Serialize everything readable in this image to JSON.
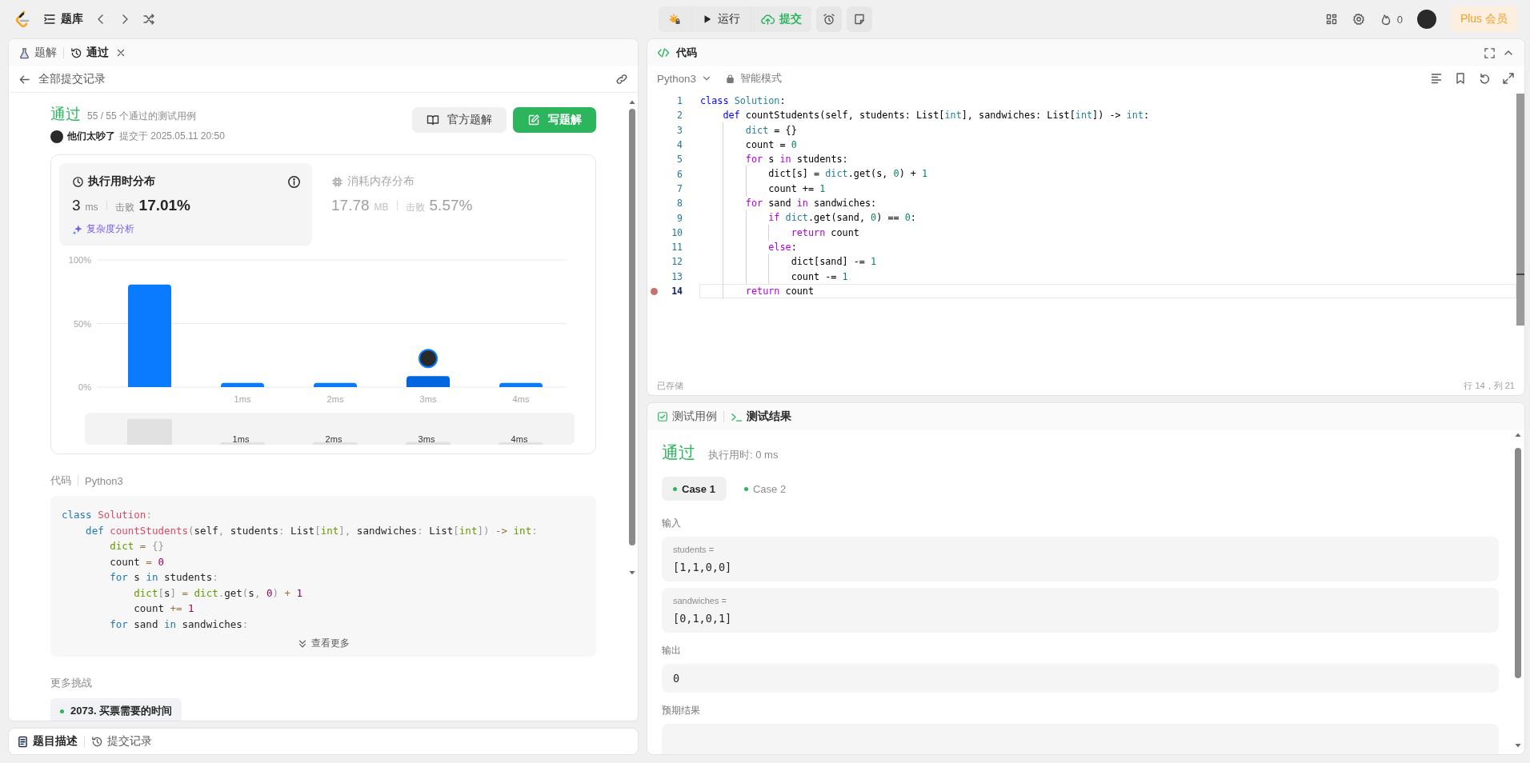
{
  "topbar": {
    "nav_label": "题库",
    "run": "运行",
    "submit": "提交",
    "streak": "0",
    "plus": "Plus 会员"
  },
  "left_panel": {
    "tabs": [
      {
        "label": "题解",
        "selected": false,
        "closable": false
      },
      {
        "label": "通过",
        "selected": true,
        "closable": true
      }
    ],
    "back_label": "全部提交记录",
    "result": {
      "status": "通过",
      "cases": "55 / 55 个通过的测试用例",
      "user": "他们太吵了",
      "submitted": "提交于 2025.05.11 20:50"
    },
    "buttons": [
      {
        "label": "官方题解",
        "kind": "secondary"
      },
      {
        "label": "写题解",
        "kind": "primary"
      }
    ],
    "stats": [
      {
        "title": "执行用时分布",
        "value": "3",
        "unit": "ms",
        "beats_label": "击败",
        "beats": "17.01%",
        "link": "复杂度分析",
        "selected": true
      },
      {
        "title": "消耗内存分布",
        "value": "17.78",
        "unit": "MB",
        "beats_label": "击败",
        "beats": "5.57%",
        "selected": false
      }
    ],
    "chart_data": {
      "type": "bar",
      "categories": [
        null,
        "1ms",
        "2ms",
        "3ms",
        "4ms"
      ],
      "values": [
        80.6,
        3.3,
        3.3,
        8.7,
        3.3
      ],
      "ylim": [
        0,
        100
      ],
      "yticks": [
        {
          "value": 0,
          "label": "0%"
        },
        {
          "value": 50,
          "label": "50%"
        },
        {
          "value": 100,
          "label": "100%"
        }
      ],
      "annotations": [
        {
          "x": "3ms"
        }
      ]
    },
    "overview_labels": [
      "1ms",
      "2ms",
      "3ms",
      "4ms"
    ],
    "code_label": "代码",
    "language": "Python3",
    "code": [
      {
        "tokens": [
          {
            "text": "class ",
            "kind": "keyword"
          },
          {
            "text": "Solution",
            "kind": "class"
          },
          {
            "text": ":",
            "kind": "punct"
          }
        ]
      },
      {
        "tokens": [
          {
            "text": "    def ",
            "kind": "keyword"
          },
          {
            "text": "countStudents",
            "kind": "function"
          },
          {
            "text": "(",
            "kind": "punct"
          },
          {
            "text": "self",
            "kind": "plain"
          },
          {
            "text": ", ",
            "kind": "punct"
          },
          {
            "text": "students",
            "kind": "plain"
          },
          {
            "text": ": ",
            "kind": "punct"
          },
          {
            "text": "List",
            "kind": "plain"
          },
          {
            "text": "[",
            "kind": "punct"
          },
          {
            "text": "int",
            "kind": "builtin"
          },
          {
            "text": "]",
            "kind": "punct"
          },
          {
            "text": ", ",
            "kind": "punct"
          },
          {
            "text": "sandwiches",
            "kind": "plain"
          },
          {
            "text": ": ",
            "kind": "punct"
          },
          {
            "text": "List",
            "kind": "plain"
          },
          {
            "text": "[",
            "kind": "punct"
          },
          {
            "text": "int",
            "kind": "builtin"
          },
          {
            "text": "])",
            "kind": "punct"
          },
          {
            "text": " -> ",
            "kind": "operator"
          },
          {
            "text": "int",
            "kind": "builtin"
          },
          {
            "text": ":",
            "kind": "punct"
          }
        ]
      },
      {
        "tokens": [
          {
            "text": "        dict",
            "kind": "builtin"
          },
          {
            "text": " = ",
            "kind": "operator"
          },
          {
            "text": "{}",
            "kind": "punct"
          }
        ]
      },
      {
        "tokens": [
          {
            "text": "        count",
            "kind": "plain"
          },
          {
            "text": " = ",
            "kind": "operator"
          },
          {
            "text": "0",
            "kind": "number"
          }
        ]
      },
      {
        "tokens": [
          {
            "text": "        for",
            "kind": "control"
          },
          {
            "text": " s ",
            "kind": "plain"
          },
          {
            "text": "in",
            "kind": "control"
          },
          {
            "text": " students",
            "kind": "plain"
          },
          {
            "text": ":",
            "kind": "punct"
          }
        ]
      },
      {
        "tokens": [
          {
            "text": "            dict",
            "kind": "builtin"
          },
          {
            "text": "[",
            "kind": "punct"
          },
          {
            "text": "s",
            "kind": "plain"
          },
          {
            "text": "]",
            "kind": "punct"
          },
          {
            "text": " = ",
            "kind": "operator"
          },
          {
            "text": "dict",
            "kind": "builtin"
          },
          {
            "text": ".",
            "kind": "punct"
          },
          {
            "text": "get",
            "kind": "plain"
          },
          {
            "text": "(",
            "kind": "punct"
          },
          {
            "text": "s",
            "kind": "plain"
          },
          {
            "text": ", ",
            "kind": "punct"
          },
          {
            "text": "0",
            "kind": "number"
          },
          {
            "text": ")",
            "kind": "punct"
          },
          {
            "text": " + ",
            "kind": "operator"
          },
          {
            "text": "1",
            "kind": "number"
          }
        ]
      },
      {
        "tokens": [
          {
            "text": "            count",
            "kind": "plain"
          },
          {
            "text": " += ",
            "kind": "operator"
          },
          {
            "text": "1",
            "kind": "number"
          }
        ]
      },
      {
        "tokens": [
          {
            "text": "        for",
            "kind": "control"
          },
          {
            "text": " sand ",
            "kind": "plain"
          },
          {
            "text": "in",
            "kind": "control"
          },
          {
            "text": " sandwiches",
            "kind": "plain"
          },
          {
            "text": ":",
            "kind": "punct"
          }
        ]
      }
    ],
    "more_button": "查看更多",
    "more_title": "更多挑战",
    "challenges": [
      "2073. 买票需要的时间"
    ]
  },
  "bottom_tabs": [
    {
      "label": "题目描述",
      "selected": true
    },
    {
      "label": "提交记录",
      "selected": false
    }
  ],
  "editor": {
    "title": "代码",
    "language": "Python3",
    "mode": "智能模式",
    "lines": [
      {
        "n": "1",
        "current": false,
        "breakpoint": false,
        "tokens": [
          {
            "text": "class ",
            "kind": "keyword"
          },
          {
            "text": "Solution",
            "kind": "class"
          },
          {
            "text": ":",
            "kind": "punct"
          }
        ]
      },
      {
        "n": "2",
        "current": false,
        "breakpoint": false,
        "tokens": [
          {
            "text": "    def ",
            "kind": "keyword"
          },
          {
            "text": "countStudents",
            "kind": "function"
          },
          {
            "text": "(self, students: List[",
            "kind": "plain"
          },
          {
            "text": "int",
            "kind": "builtin"
          },
          {
            "text": "], sandwiches: List[",
            "kind": "plain"
          },
          {
            "text": "int",
            "kind": "builtin"
          },
          {
            "text": "]) -> ",
            "kind": "plain"
          },
          {
            "text": "int",
            "kind": "builtin"
          },
          {
            "text": ":",
            "kind": "plain"
          }
        ]
      },
      {
        "n": "3",
        "current": false,
        "breakpoint": false,
        "tokens": [
          {
            "text": "        dict",
            "kind": "builtin"
          },
          {
            "text": " = {}",
            "kind": "plain"
          }
        ]
      },
      {
        "n": "4",
        "current": false,
        "breakpoint": false,
        "tokens": [
          {
            "text": "        count = ",
            "kind": "plain"
          },
          {
            "text": "0",
            "kind": "number"
          }
        ]
      },
      {
        "n": "5",
        "current": false,
        "breakpoint": false,
        "tokens": [
          {
            "text": "        for",
            "kind": "control"
          },
          {
            "text": " s ",
            "kind": "plain"
          },
          {
            "text": "in",
            "kind": "control"
          },
          {
            "text": " students:",
            "kind": "plain"
          }
        ]
      },
      {
        "n": "6",
        "current": false,
        "breakpoint": false,
        "tokens": [
          {
            "text": "            dict[s] = ",
            "kind": "plain"
          },
          {
            "text": "dict",
            "kind": "builtin"
          },
          {
            "text": ".get(s, ",
            "kind": "plain"
          },
          {
            "text": "0",
            "kind": "number"
          },
          {
            "text": ") + ",
            "kind": "plain"
          },
          {
            "text": "1",
            "kind": "number"
          }
        ]
      },
      {
        "n": "7",
        "current": false,
        "breakpoint": false,
        "tokens": [
          {
            "text": "            count += ",
            "kind": "plain"
          },
          {
            "text": "1",
            "kind": "number"
          }
        ]
      },
      {
        "n": "8",
        "current": false,
        "breakpoint": false,
        "tokens": [
          {
            "text": "        for",
            "kind": "control"
          },
          {
            "text": " sand ",
            "kind": "plain"
          },
          {
            "text": "in",
            "kind": "control"
          },
          {
            "text": " sandwiches:",
            "kind": "plain"
          }
        ]
      },
      {
        "n": "9",
        "current": false,
        "breakpoint": false,
        "tokens": [
          {
            "text": "            if ",
            "kind": "control"
          },
          {
            "text": "dict",
            "kind": "builtin"
          },
          {
            "text": ".get(sand, ",
            "kind": "plain"
          },
          {
            "text": "0",
            "kind": "number"
          },
          {
            "text": ") == ",
            "kind": "plain"
          },
          {
            "text": "0",
            "kind": "number"
          },
          {
            "text": ":",
            "kind": "plain"
          }
        ]
      },
      {
        "n": "10",
        "current": false,
        "breakpoint": false,
        "tokens": [
          {
            "text": "                return",
            "kind": "control"
          },
          {
            "text": " count",
            "kind": "plain"
          }
        ]
      },
      {
        "n": "11",
        "current": false,
        "breakpoint": false,
        "tokens": [
          {
            "text": "            else",
            "kind": "control"
          },
          {
            "text": ":",
            "kind": "plain"
          }
        ]
      },
      {
        "n": "12",
        "current": false,
        "breakpoint": false,
        "tokens": [
          {
            "text": "                dict[sand] -= ",
            "kind": "plain"
          },
          {
            "text": "1",
            "kind": "number"
          }
        ]
      },
      {
        "n": "13",
        "current": false,
        "breakpoint": false,
        "tokens": [
          {
            "text": "                count -= ",
            "kind": "plain"
          },
          {
            "text": "1",
            "kind": "number"
          }
        ]
      },
      {
        "n": "14",
        "current": true,
        "breakpoint": true,
        "tokens": [
          {
            "text": "        return",
            "kind": "control"
          },
          {
            "text": " count",
            "kind": "plain"
          }
        ]
      }
    ],
    "status_left": "已存储",
    "status_right": "行 14，列 21"
  },
  "console": {
    "tabs": [
      {
        "label": "测试用例",
        "selected": false
      },
      {
        "label": "测试结果",
        "selected": true
      }
    ],
    "status": "通过",
    "runtime": "执行用时: 0 ms",
    "cases": [
      {
        "label": "Case 1",
        "selected": true
      },
      {
        "label": "Case 2",
        "selected": false
      }
    ],
    "input_label": "输入",
    "inputs": [
      {
        "name": "students =",
        "value": "[1,1,0,0]"
      },
      {
        "name": "sandwiches =",
        "value": "[0,1,0,1]"
      }
    ],
    "output_label": "输出",
    "output": "0",
    "expected_label": "预期结果"
  }
}
